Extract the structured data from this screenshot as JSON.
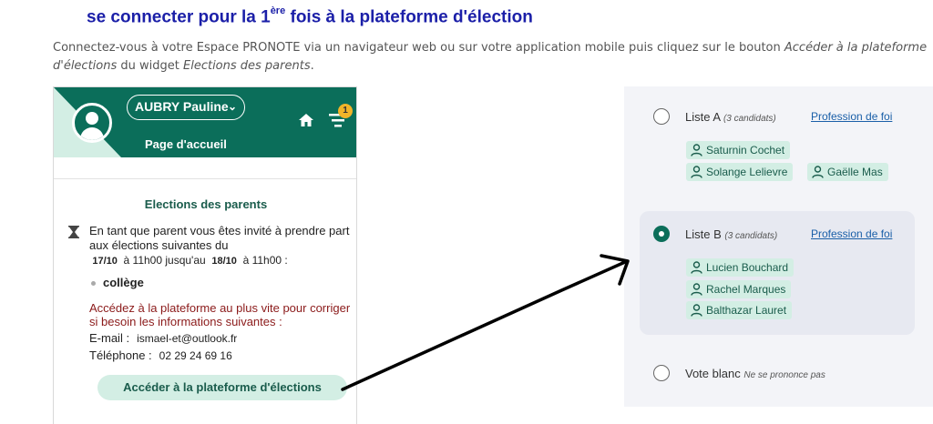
{
  "heading": {
    "prefix": "se connecter pour la 1",
    "sup": "ère",
    "suffix": " fois à la plateforme d'élection"
  },
  "intro": {
    "p1": "Connectez-vous à votre Espace PRONOTE via un navigateur web ou sur votre application mobile puis cliquez sur le bouton ",
    "em1": "Accéder à la plateforme d'élections",
    "p2": " du widget ",
    "em2": "Elections des parents",
    "p3": "."
  },
  "widget": {
    "user_name": "AUBRY Pauline",
    "page_label": "Page d'accueil",
    "notification_count": "1",
    "title": "Elections des parents",
    "invite_text": "En tant que parent vous êtes invité à prendre part aux élections suivantes du",
    "date_from": "17/10",
    "time_from": "à 11h00 jusqu'au",
    "date_to": "18/10",
    "time_to": "à 11h00 :",
    "school": "collège",
    "warning": "Accédez à la plateforme au plus vite pour corriger si besoin les informations suivantes :",
    "email_label": "E-mail :",
    "email_value": "ismael-et@outlook.fr",
    "phone_label": "Téléphone :",
    "phone_value": "02 29 24 69 16",
    "access_button": "Accéder à la plateforme d'élections"
  },
  "ballot": {
    "list_a": {
      "name": "Liste A",
      "count": "(3 candidats)",
      "link": "Profession de foi",
      "candidates": [
        "Saturnin Cochet",
        "Solange Lelievre",
        "Gaëlle Mas"
      ],
      "selected": false
    },
    "list_b": {
      "name": "Liste B",
      "count": "(3 candidats)",
      "link": "Profession de foi",
      "candidates": [
        "Lucien Bouchard",
        "Rachel Marques",
        "Balthazar Lauret"
      ],
      "selected": true
    },
    "blank": {
      "name": "Vote blanc",
      "note": "Ne se prononce pas"
    }
  },
  "colors": {
    "brand_green": "#0b6e5a",
    "chip_green": "#d3eee4",
    "heading_blue": "#1b1fa8",
    "warning_red": "#8b1a1a",
    "badge_yellow": "#f0b429"
  },
  "icons": [
    "user-avatar-icon",
    "chevron-down-icon",
    "home-icon",
    "menu-icon",
    "hourglass-icon",
    "person-icon",
    "radio-icon",
    "arrow-annotation"
  ]
}
